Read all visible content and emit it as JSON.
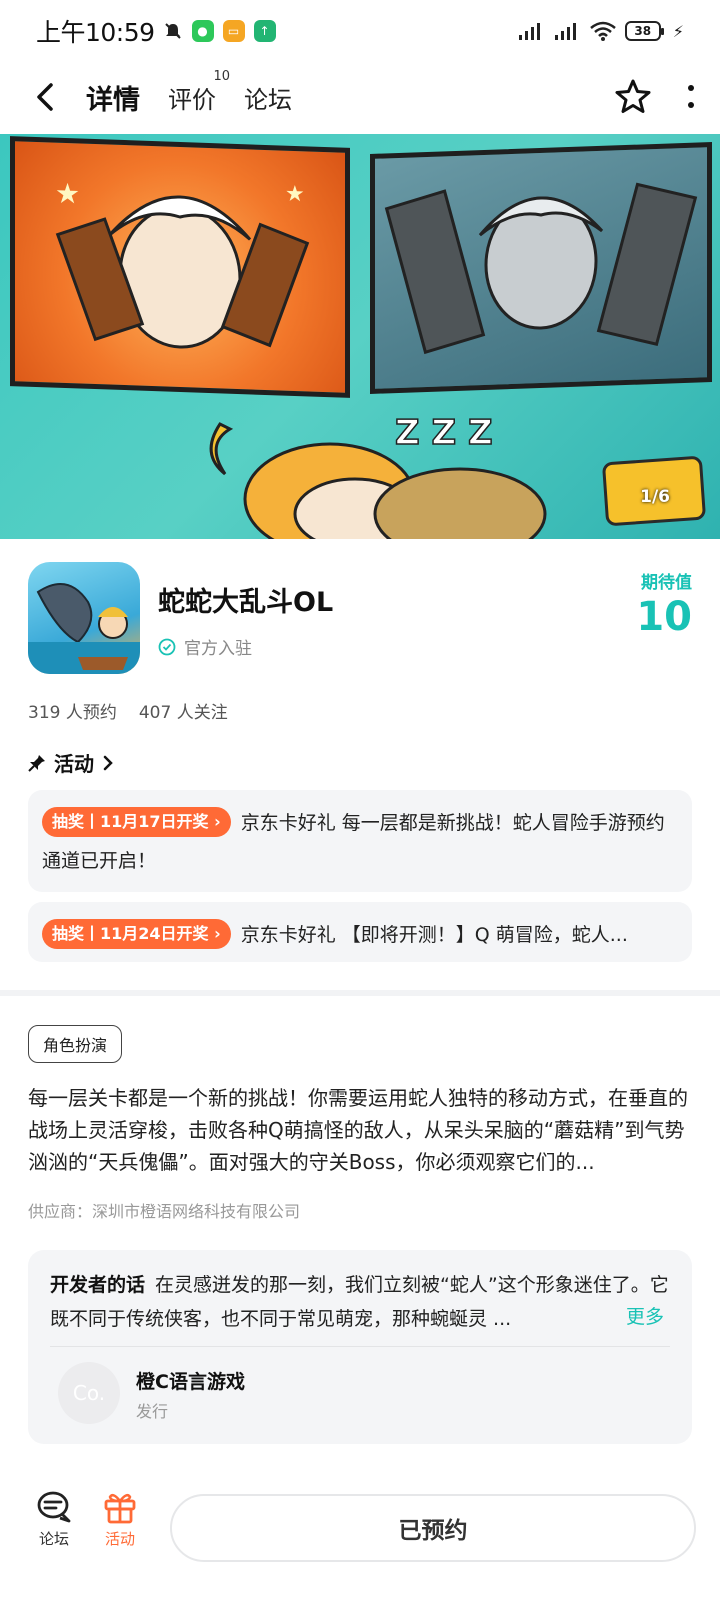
{
  "status_bar": {
    "time": "上午10:59",
    "battery": "38"
  },
  "header": {
    "tabs": [
      {
        "label": "详情",
        "active": true
      },
      {
        "label": "评价",
        "count": "10"
      },
      {
        "label": "论坛"
      }
    ]
  },
  "banner": {
    "counter": "1/6"
  },
  "game": {
    "title": "蛇蛇大乱斗OL",
    "official_label": "官方入驻",
    "expect_label": "期待值",
    "expect_value": "10",
    "reservations": "319 人预约",
    "followers": "407 人关注"
  },
  "activity": {
    "heading": "活动",
    "items": [
      {
        "badge": "抽奖丨11月17日开奖",
        "text": "京东卡好礼 每一层都是新挑战！蛇人冒险手游预约通道已开启！"
      },
      {
        "badge": "抽奖丨11月24日开奖",
        "text": "京东卡好礼 【即将开测！】Q 萌冒险，蛇人..."
      }
    ]
  },
  "description": {
    "tag": "角色扮演",
    "text": "每一层关卡都是一个新的挑战！你需要运用蛇人独特的移动方式，在垂直的战场上灵活穿梭，击败各种Q萌搞怪的敌人，从呆头呆脑的“蘑菇精”到气势汹汹的“天兵傀儡”。面对强大的守关Boss，你必须观察它们的...",
    "supplier": "供应商：深圳市橙语网络科技有限公司"
  },
  "developer": {
    "heading": "开发者的话",
    "words": "在灵感迸发的那一刻，我们立刻被“蛇人”这个形象迷住了。它既不同于传统侠客，也不同于常见萌宠，那种蜿蜒灵 ...",
    "more": "更多",
    "avatar_text": "Co.",
    "name": "橙C语言游戏",
    "role": "发行"
  },
  "bottom_bar": {
    "forum_label": "论坛",
    "activity_label": "活动",
    "reserve_label": "已预约"
  },
  "colors": {
    "accent": "#19c2b5",
    "activity_orange": "#ff6a36"
  }
}
